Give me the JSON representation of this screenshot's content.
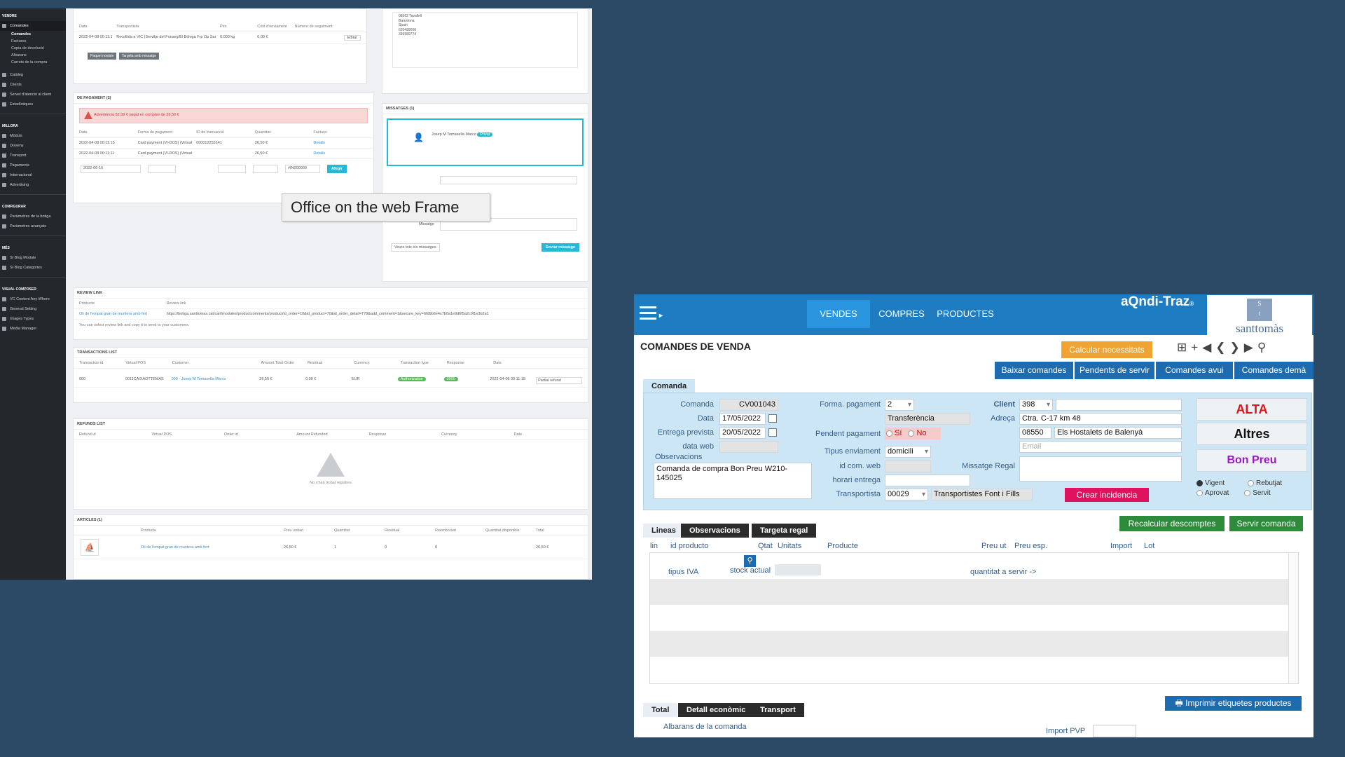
{
  "left_app": {
    "sidebar": {
      "sections": [
        {
          "title": "Vendre",
          "items": [
            {
              "label": "Comandes",
              "active": true,
              "subs": [
                "Comandes",
                "Factures",
                "Copia de devolució",
                "Albarans",
                "Carrets de la compra"
              ]
            },
            {
              "label": "Catàleg"
            },
            {
              "label": "Clients"
            },
            {
              "label": "Servei d'atenció al client"
            },
            {
              "label": "Estadístiques"
            }
          ]
        },
        {
          "title": "Millora",
          "items": [
            {
              "label": "Mòduls"
            },
            {
              "label": "Disseny"
            },
            {
              "label": "Transport"
            },
            {
              "label": "Pagaments"
            },
            {
              "label": "Internacional"
            },
            {
              "label": "Advertising"
            }
          ]
        },
        {
          "title": "Configurar",
          "items": [
            {
              "label": "Paràmetres de la botiga"
            },
            {
              "label": "Paràmetres avançats"
            }
          ]
        },
        {
          "title": "Més",
          "items": [
            {
              "label": "SI Blog Module"
            },
            {
              "label": "SI Blog Categories"
            }
          ]
        },
        {
          "title": "Visual Composer",
          "items": [
            {
              "label": "VC Content Any Where"
            },
            {
              "label": "General Setting"
            },
            {
              "label": "Images Types"
            },
            {
              "label": "Media Manager"
            }
          ]
        }
      ]
    },
    "tooltip": "Office on the web Frame",
    "shipping": {
      "headers": [
        "Data",
        "Transportista",
        "Pes",
        "Cost d'enviament",
        "Número de seguiment"
      ],
      "row": [
        "2022-04-08 00:11:15",
        "Recollida a VIC (Servitje del Fonseg/El Bologa Frp Op Sant Tomàs)",
        "0.000 kg",
        "0,00 €"
      ],
      "edit": "Editar",
      "buttons": [
        "Paquet noviate",
        "Targeta amb missatge"
      ]
    },
    "address_lines": [
      "08562 Tavallell",
      "Barcelona",
      "Spain",
      "620499060",
      "336589774"
    ],
    "payment": {
      "title": "De pagament",
      "count": "2",
      "alert": "Advertència 52,99 € pagat en comptes de 26,50 €",
      "headers": [
        "Data",
        "Forma de pagament",
        "ID de transacció",
        "Quantitat",
        "Factura"
      ],
      "rows": [
        [
          "2022-04-08 00:11:15",
          "Card payment (VI-DOS) (Virtual POS)",
          "000012255141",
          "26,50 €",
          "Detalls"
        ],
        [
          "2022-04-08 00:11:11",
          "Card payment (VI-DOS) (Virtual POS)",
          "",
          "26,50 €",
          "Detalls"
        ]
      ],
      "date_input": "2022-06-16",
      "invoice_select": "#IN000000",
      "add": "Afegir"
    },
    "messages": {
      "title": "Missatges",
      "count": "1",
      "author": "Josep M Tomasella Marco",
      "badge": "Privat",
      "message_label": "Missatge",
      "view_all": "Veure tots els missatges",
      "send": "Enviar missatge"
    },
    "review": {
      "title": "Review link",
      "headers": [
        "Producte",
        "Review link"
      ],
      "product": "Oli de l'empat gran de muntera amb fert",
      "url": "https://botiga.santtomas.cat/cart/modules/productcomments/product/id_order=10&id_product=70&id_order_detail=778&add_comment=1&secure_key=6fd9b6e4c7b0a1e9d6f5a2c0f1e3b2a1",
      "note": "You can select review link and copy it to send to your customers."
    },
    "transactions": {
      "title": "Transactions list",
      "headers": [
        "Transaction id",
        "Virtual POS",
        "Customer",
        "Amount Total Order",
        "Residual",
        "Currency",
        "Transaction type",
        "Response",
        "Date"
      ],
      "row": [
        "000",
        "0011CAIXAOTTEMAS",
        "000 - Josep M Tomasella Marco",
        "26,50 €",
        "0,00 €",
        "EUR",
        "Authorization",
        "0000",
        "2022-04-08 00:11:18"
      ],
      "select": "Partial refund"
    },
    "refunds": {
      "title": "Refunds list",
      "headers": [
        "Refund id",
        "Virtual POS",
        "Order id",
        "Amount Refunded",
        "Response",
        "Currency",
        "Date"
      ],
      "empty": "No s'han trobat registres"
    },
    "articles": {
      "title": "Articles",
      "count": "1",
      "headers": [
        "Producte",
        "Preu unitari",
        "Quantitat",
        "Residual",
        "Reemborsat",
        "Quantitat disponible",
        "Total"
      ],
      "row": [
        "Oli de l'empat gran de muntera amb fert",
        "26,50 €",
        "1",
        "0",
        "0",
        "26,50 €"
      ]
    }
  },
  "aqndi": {
    "nav": [
      "VENDES",
      "COMPRES",
      "PRODUCTES"
    ],
    "brand": "aQndi-Traz",
    "brand_suffix": "®",
    "logo_letters": [
      "S",
      "t"
    ],
    "logo_name": "santtomàs",
    "title": "COMANDES DE VENDA",
    "calc_button": "Calcular necessitats",
    "tool_icons": [
      "⊞",
      "+",
      "◀",
      "❮",
      "❯",
      "▶",
      "⚲"
    ],
    "action_buttons": [
      "Baixar comandes",
      "Pendents de servir",
      "Comandes avui",
      "Comandes demà"
    ],
    "form_tab": "Comanda",
    "form": {
      "comanda_label": "Comanda",
      "comanda": "CV001043",
      "data_label": "Data",
      "data": "17/05/2022",
      "entrega_label": "Entrega prevista",
      "entrega": "20/05/2022",
      "dataweb_label": "data web",
      "obs_label": "Observacions",
      "obs": "Comanda de compra Bon Preu W210-145025",
      "forma_label": "Forma. pagament",
      "forma_code": "2",
      "forma": "Transferència",
      "pendent_label": "Pendent pagament",
      "si": "Sí",
      "no": "No",
      "tipus_label": "Tipus enviament",
      "tipus": "domicili",
      "idcom_label": "id com. web",
      "horari_label": "horari entrega",
      "transp_label": "Transportista",
      "transp_code": "00029",
      "transp": "Transportistes Font i Fills",
      "client_label": "Client",
      "client": "398",
      "adreca_label": "Adreça",
      "adreca": "Ctra. C-17 km 48",
      "cp": "08550",
      "poblacio": "Els Hostalets de Balenyà",
      "email_placeholder": "Email",
      "missatge_label": "Missatge Regal",
      "crear": "Crear incidencia"
    },
    "status": {
      "alta": "ALTA",
      "altres": "Altres",
      "bonpreu": "Bon Preu"
    },
    "status_colors": {
      "alta": "#e0111b",
      "altres": "#111111",
      "bonpreu": "#9a18c9"
    },
    "radios": [
      "Vigent",
      "Rebutjat",
      "Aprovat",
      "Servit"
    ],
    "lines_tabs": [
      "Lineas",
      "Observacions",
      "Targeta regal"
    ],
    "green_buttons": [
      "Recalcular descomptes",
      "Servir comanda"
    ],
    "columns": [
      "lin",
      "id producto",
      "Qtat",
      "Unitats",
      "Producte",
      "Preu ut",
      "Preu esp.",
      "Import",
      "Lot"
    ],
    "row_labels": {
      "tipus_iva": "tipus IVA",
      "stock": "stock actual",
      "servir": "quantitat a servir ->"
    },
    "bottom_tabs": [
      "Total",
      "Detall econòmic",
      "Transport"
    ],
    "imprimir": "Imprimir etiquetes productes",
    "albarans": "Albarans de la comanda",
    "import_pvp": "Import PVP"
  }
}
